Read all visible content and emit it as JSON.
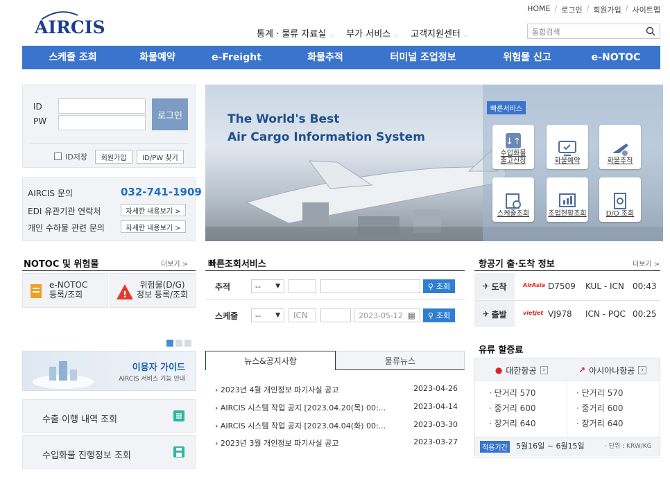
{
  "logo": {
    "text": "AIRCIS"
  },
  "util_links": [
    "HOME",
    "로그인",
    "회원가입",
    "사이트맵"
  ],
  "sub_menu": [
    "통계 · 물류 자료실",
    "부가 서비스",
    "고객지원센터"
  ],
  "search": {
    "placeholder": "통합검색"
  },
  "nav": [
    "스케줄 조회",
    "화물예약",
    "e-Freight",
    "화물추적",
    "터미널 조업정보",
    "위험물 신고",
    "e-NOTOC"
  ],
  "login": {
    "id_label": "ID",
    "pw_label": "PW",
    "login_button": "로그인",
    "save_id": "ID저장",
    "join": "회원가입",
    "find": "ID/PW 찾기"
  },
  "contact": {
    "rows": [
      {
        "label": "AIRCIS 문의",
        "value": "032-741-1909"
      },
      {
        "label": "EDI 유관기관 연락처",
        "value": "자세한 내용보기 >"
      },
      {
        "label": "개인 수하물 관련 문의",
        "value": "자세한 내용보기 >"
      }
    ]
  },
  "banner": {
    "line1": "The World's Best",
    "line2": "Air Cargo Information System",
    "quick_title": "빠른서비스",
    "quick": [
      "수입화물\n출고신청",
      "화물예약",
      "화물추적",
      "스케줄조회",
      "조업현황조회",
      "D/O 조회"
    ]
  },
  "notoc": {
    "title": "NOTOC 및 위험물",
    "more": "더보기 >",
    "item1": "e-NOTOC\n등록/조회",
    "item2": "위험물(D/G)\n정보 등록/조회"
  },
  "quicksearch": {
    "title": "빠른조회서비스",
    "track_label": "추적",
    "sched_label": "스케줄",
    "dash": "--",
    "origin": "ICN",
    "date": "2023-05-12",
    "btn": "조회"
  },
  "flight": {
    "title": "항공기 출·도착 정보",
    "more": "더보기 >",
    "rows": [
      {
        "kind": "도착",
        "airline": "AirAsia",
        "no": "D7509",
        "route": "KUL - ICN",
        "time": "00:43"
      },
      {
        "kind": "출발",
        "airline": "vietjet",
        "no": "VJ978",
        "route": "ICN - PQC",
        "time": "00:25"
      }
    ]
  },
  "guide": {
    "title": "이용자 가이드",
    "sub": "AIRCIS 서비스 기능 안내"
  },
  "side_links": [
    "수출 이행 내역 조회",
    "수입화물 진행정보 조회"
  ],
  "news": {
    "tabs": [
      "뉴스&공지사항",
      "물류뉴스"
    ],
    "items": [
      {
        "title": "2023년 4월 개인정보 파기사실 공고",
        "date": "2023-04-26"
      },
      {
        "title": "AIRCIS 시스템 작업 공지 [2023.04.20(목) 00:...",
        "date": "2023-04-14"
      },
      {
        "title": "AIRCIS 시스템 작업 공지 [2023.04.04(화) 00:...",
        "date": "2023-03-30"
      },
      {
        "title": "2023년 3월 개인정보 파기사실 공고",
        "date": "2023-03-27"
      }
    ]
  },
  "fuel": {
    "title": "유류 할증료",
    "korean": "대한항공",
    "asiana": "아시아나항공",
    "rows": [
      {
        "label": "· 단거리",
        "ke": "570",
        "oz": "570"
      },
      {
        "label": "· 중거리",
        "ke": "600",
        "oz": "600"
      },
      {
        "label": "· 장거리",
        "ke": "640",
        "oz": "640"
      }
    ],
    "period_label": "적용기간",
    "period": "5월16일 ~ 6월15일",
    "unit": "· 단위 : KRW/KG"
  },
  "colors": {
    "nav": "#3a74cc",
    "accent": "#2f7fd0",
    "phone": "#1f6fc6"
  }
}
